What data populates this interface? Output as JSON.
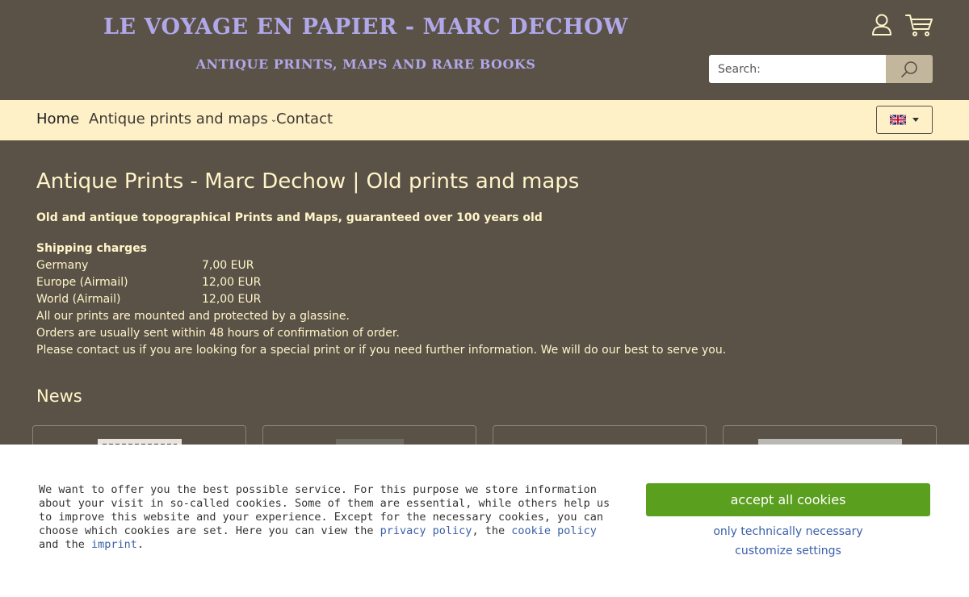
{
  "header": {
    "title": "LE VOYAGE EN PAPIER - MARC DECHOW",
    "subtitle": "ANTIQUE PRINTS, MAPS AND RARE BOOKS",
    "search_placeholder": "Search:",
    "account_icon": "user-icon",
    "cart_icon": "cart-icon",
    "search_icon": "magnifier-icon"
  },
  "nav": {
    "items": [
      {
        "label": "Home"
      },
      {
        "label": "Antique prints and maps"
      },
      {
        "label": "Contact"
      }
    ],
    "language_icon": "uk-flag-icon"
  },
  "main": {
    "title": "Antique Prints - Marc Dechow | Old prints and maps",
    "intro": "Old and antique topographical Prints and Maps, guaranteed over 100 years old",
    "shipping_heading": "Shipping charges",
    "shipping_rows": [
      {
        "region": "Germany",
        "price": "7,00 EUR"
      },
      {
        "region": "Europe (Airmail)",
        "price": "12,00 EUR"
      },
      {
        "region": "World (Airmail)",
        "price": "12,00 EUR"
      }
    ],
    "notes": [
      "All our prints are mounted and protected by a glassine.",
      "Orders are usually sent within 48 hours of confirmation of order.",
      "Please contact us if you are looking for a special print or if you need further information. We will do our best to serve you."
    ],
    "news_heading": "News"
  },
  "cookie": {
    "text_1": "We want to offer you the best possible service. For this purpose we store information about your visit in so-called cookies. Some of them are essential, while others help us to improve this website and your experience. Except for the necessary cookies, you can choose which cookies are set. Here you can view the ",
    "privacy_link": "privacy policy",
    "text_2": ", the ",
    "cookie_link": "cookie policy",
    "text_3": " and the ",
    "imprint_link": "imprint",
    "text_4": ".",
    "accept_label": "accept all cookies",
    "necessary_label": "only technically necessary",
    "customize_label": "customize settings"
  },
  "colors": {
    "background": "#5a5147",
    "nav_background": "#fef0c7",
    "brand_text": "#b0a8e8",
    "accept_button": "#5b9f1f",
    "link": "#3b5fa8"
  }
}
